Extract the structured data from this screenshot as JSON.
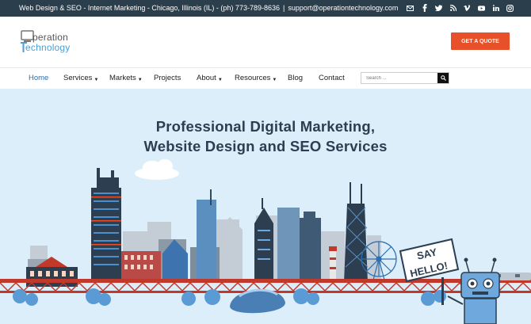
{
  "topbar": {
    "tagline": "Web Design & SEO - Internet Marketing - Chicago, Illinois (IL) - (ph) 773-789-8636",
    "separator": "|",
    "email": "support@operationtechnology.com",
    "social_icons": [
      "mail-icon",
      "facebook-icon",
      "twitter-icon",
      "rss-icon",
      "vimeo-icon",
      "youtube-icon",
      "linkedin-icon",
      "instagram-icon"
    ]
  },
  "logo": {
    "line1": "peration",
    "line2": "echnology"
  },
  "header": {
    "cta_label": "GET A QUOTE"
  },
  "nav": {
    "items": [
      {
        "label": "Home",
        "dropdown": false
      },
      {
        "label": "Services",
        "dropdown": true
      },
      {
        "label": "Markets",
        "dropdown": true
      },
      {
        "label": "Projects",
        "dropdown": false
      },
      {
        "label": "About",
        "dropdown": true
      },
      {
        "label": "Resources",
        "dropdown": true
      },
      {
        "label": "Blog",
        "dropdown": false
      },
      {
        "label": "Contact",
        "dropdown": false
      }
    ],
    "caret": "▼",
    "search_placeholder": "Search ..."
  },
  "hero": {
    "title_line1": "Professional Digital Marketing,",
    "title_line2": "Website Design and SEO Services",
    "sign_line1": "SAY",
    "sign_line2": "HELLO!"
  },
  "colors": {
    "topbar": "#2b3e4c",
    "accent": "#e8502a",
    "link_active": "#2b6fae",
    "hero_bg": "#dceefa",
    "bridge": "#c0392b"
  }
}
